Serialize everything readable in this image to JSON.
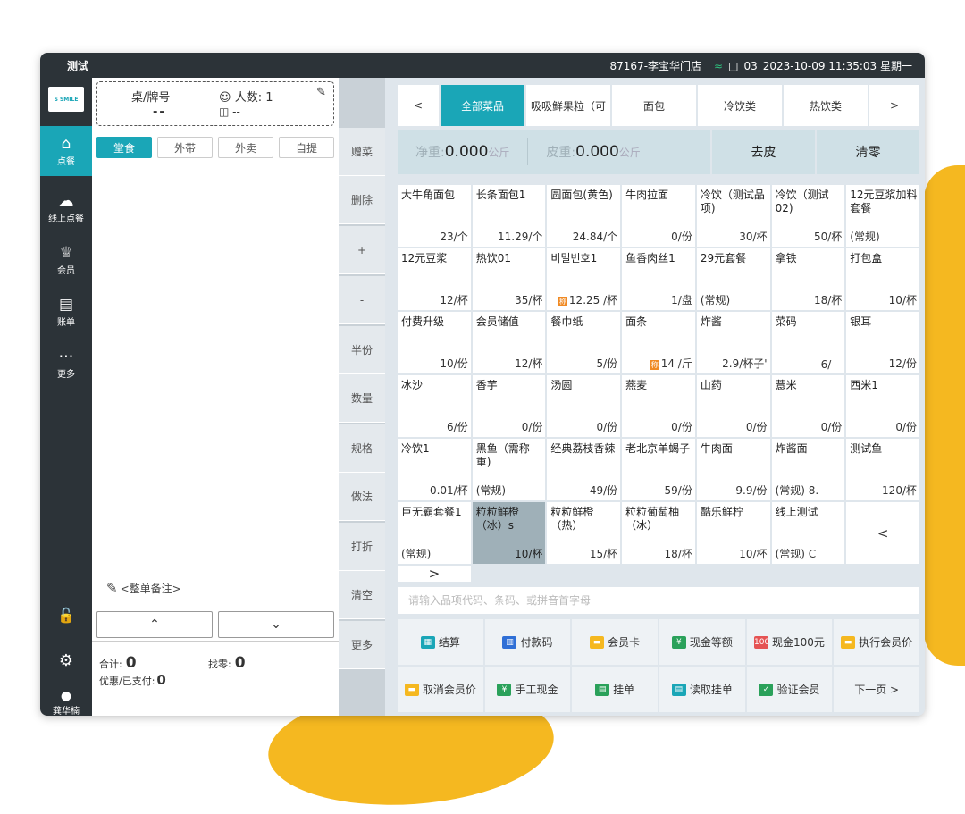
{
  "colors": {
    "accent": "#1aa6b7",
    "dark": "#2c3338",
    "highlight": "#f5b820",
    "badge": "#f08a24"
  },
  "topbar": {
    "title": "测试",
    "store": "87167-李宝华门店",
    "terminal": "03",
    "datetime": "2023-10-09 11:35:03 星期一"
  },
  "nav": {
    "logo": "S SMILE",
    "items": [
      {
        "label": "点餐",
        "icon": "home-icon"
      },
      {
        "label": "线上点餐",
        "icon": "cloud-icon"
      },
      {
        "label": "会员",
        "icon": "crown-icon"
      },
      {
        "label": "账单",
        "icon": "bill-icon"
      },
      {
        "label": "更多",
        "icon": "more-icon"
      }
    ],
    "user": "龚华楠"
  },
  "order": {
    "table_label": "桌/牌号",
    "table_value": "--",
    "people_label": "人数: 1",
    "seat_value": "--",
    "modes": [
      "堂食",
      "外带",
      "外卖",
      "自提"
    ],
    "note_label": "<整单备注>",
    "total_label": "合计:",
    "total_value": "0",
    "change_label": "找零:",
    "change_value": "0",
    "paid_label": "优惠/已支付:",
    "paid_value": "0"
  },
  "actions": [
    "赠菜",
    "删除",
    "+",
    "-",
    "半份",
    "数量",
    "规格",
    "做法",
    "打折",
    "清空",
    "更多"
  ],
  "tabs": {
    "prev": "<",
    "next": ">",
    "items": [
      "全部菜品",
      "吸吸鲜果粒（可",
      "面包",
      "冷饮类",
      "热饮类"
    ]
  },
  "scale": {
    "net_label": "净重:",
    "net_value": "0.000",
    "net_unit": "公斤",
    "tare_label": "皮重:",
    "tare_value": "0.000",
    "tare_unit": "公斤",
    "tare_button": "去皮",
    "zero_button": "清零"
  },
  "products": [
    {
      "name": "大牛角面包",
      "price": "23/个"
    },
    {
      "name": "长条面包1",
      "price": "11.29/个"
    },
    {
      "name": "圆面包(黄色)",
      "price": "24.84/个"
    },
    {
      "name": "牛肉拉面",
      "price": "0/份"
    },
    {
      "name": "冷饮（测试品项)",
      "price": "30/杯"
    },
    {
      "name": "冷饮（测试02)",
      "price": "50/杯"
    },
    {
      "name": "12元豆浆加料套餐",
      "price": "(常规)",
      "left": true
    },
    {
      "name": "12元豆浆",
      "price": "12/杯"
    },
    {
      "name": "热饮01",
      "price": "35/杯"
    },
    {
      "name": "비밀번호1",
      "price": "12.25 /杯",
      "badge": "称"
    },
    {
      "name": "鱼香肉丝1",
      "price": "1/盘"
    },
    {
      "name": "29元套餐",
      "price": "(常规)",
      "left": true
    },
    {
      "name": "拿铁",
      "price": "18/杯"
    },
    {
      "name": "打包盒",
      "price": "10/杯"
    },
    {
      "name": "付费升级",
      "price": "10/份"
    },
    {
      "name": "会员储值",
      "price": "12/杯"
    },
    {
      "name": "餐巾纸",
      "price": "5/份"
    },
    {
      "name": "面条",
      "price": "14 /斤",
      "badge": "称"
    },
    {
      "name": "炸酱",
      "price": "2.9/杯子'"
    },
    {
      "name": "菜码",
      "price": "6/—"
    },
    {
      "name": "银耳",
      "price": "12/份"
    },
    {
      "name": "冰沙",
      "price": "6/份"
    },
    {
      "name": "香芋",
      "price": "0/份"
    },
    {
      "name": "汤圆",
      "price": "0/份"
    },
    {
      "name": "燕麦",
      "price": "0/份"
    },
    {
      "name": "山药",
      "price": "0/份"
    },
    {
      "name": "薏米",
      "price": "0/份"
    },
    {
      "name": "西米1",
      "price": "0/份"
    },
    {
      "name": "冷饮1",
      "price": "0.01/杯"
    },
    {
      "name": "黑鱼（需称重)",
      "price": "(常规)",
      "left": true
    },
    {
      "name": "经典荔枝香辣",
      "price": "49/份"
    },
    {
      "name": "老北京羊蝎子",
      "price": "59/份"
    },
    {
      "name": "牛肉面",
      "price": "9.9/份"
    },
    {
      "name": "炸酱面",
      "price": "(常规)   8.",
      "left": true
    },
    {
      "name": "测试鱼",
      "price": "120/杯"
    },
    {
      "name": "巨无霸套餐1",
      "price": "(常规)",
      "left": true
    },
    {
      "name": "粒粒鲜橙（冰）s",
      "price": "10/杯",
      "selected": true
    },
    {
      "name": "粒粒鲜橙（热）",
      "price": "15/杯"
    },
    {
      "name": "粒粒葡萄柚（冰）",
      "price": "18/杯"
    },
    {
      "name": "酷乐鲜柠",
      "price": "10/杯"
    },
    {
      "name": "线上测试",
      "price": "(常规)   C",
      "left": true
    }
  ],
  "grid_nav": {
    "prev": "<",
    "next": ">"
  },
  "search": {
    "placeholder": "请输入品项代码、条码、或拼音首字母"
  },
  "function_buttons": [
    {
      "label": "结算",
      "icon": "calculator-icon",
      "color": "#1aa6b7",
      "glyph": "▦"
    },
    {
      "label": "付款码",
      "icon": "barcode-icon",
      "color": "#2f6fd6",
      "glyph": "▥"
    },
    {
      "label": "会员卡",
      "icon": "card-icon",
      "color": "#f5b820",
      "glyph": "▬"
    },
    {
      "label": "现金等额",
      "icon": "cash-icon",
      "color": "#2aa15a",
      "glyph": "¥"
    },
    {
      "label": "现金100元",
      "icon": "cash100-icon",
      "color": "#e55353",
      "glyph": "100"
    },
    {
      "label": "执行会员价",
      "icon": "member-price-icon",
      "color": "#f5b820",
      "glyph": "▬"
    },
    {
      "label": "取消会员价",
      "icon": "cancel-member-price-icon",
      "color": "#f5b820",
      "glyph": "▬"
    },
    {
      "label": "手工现金",
      "icon": "manual-cash-icon",
      "color": "#2aa15a",
      "glyph": "¥"
    },
    {
      "label": "挂单",
      "icon": "hold-order-icon",
      "color": "#2aa15a",
      "glyph": "▤"
    },
    {
      "label": "读取挂单",
      "icon": "read-hold-icon",
      "color": "#1aa6b7",
      "glyph": "▤"
    },
    {
      "label": "验证会员",
      "icon": "verify-member-icon",
      "color": "#2aa15a",
      "glyph": "✓"
    },
    {
      "label": "下一页 >",
      "icon": "",
      "color": "",
      "glyph": ""
    }
  ]
}
